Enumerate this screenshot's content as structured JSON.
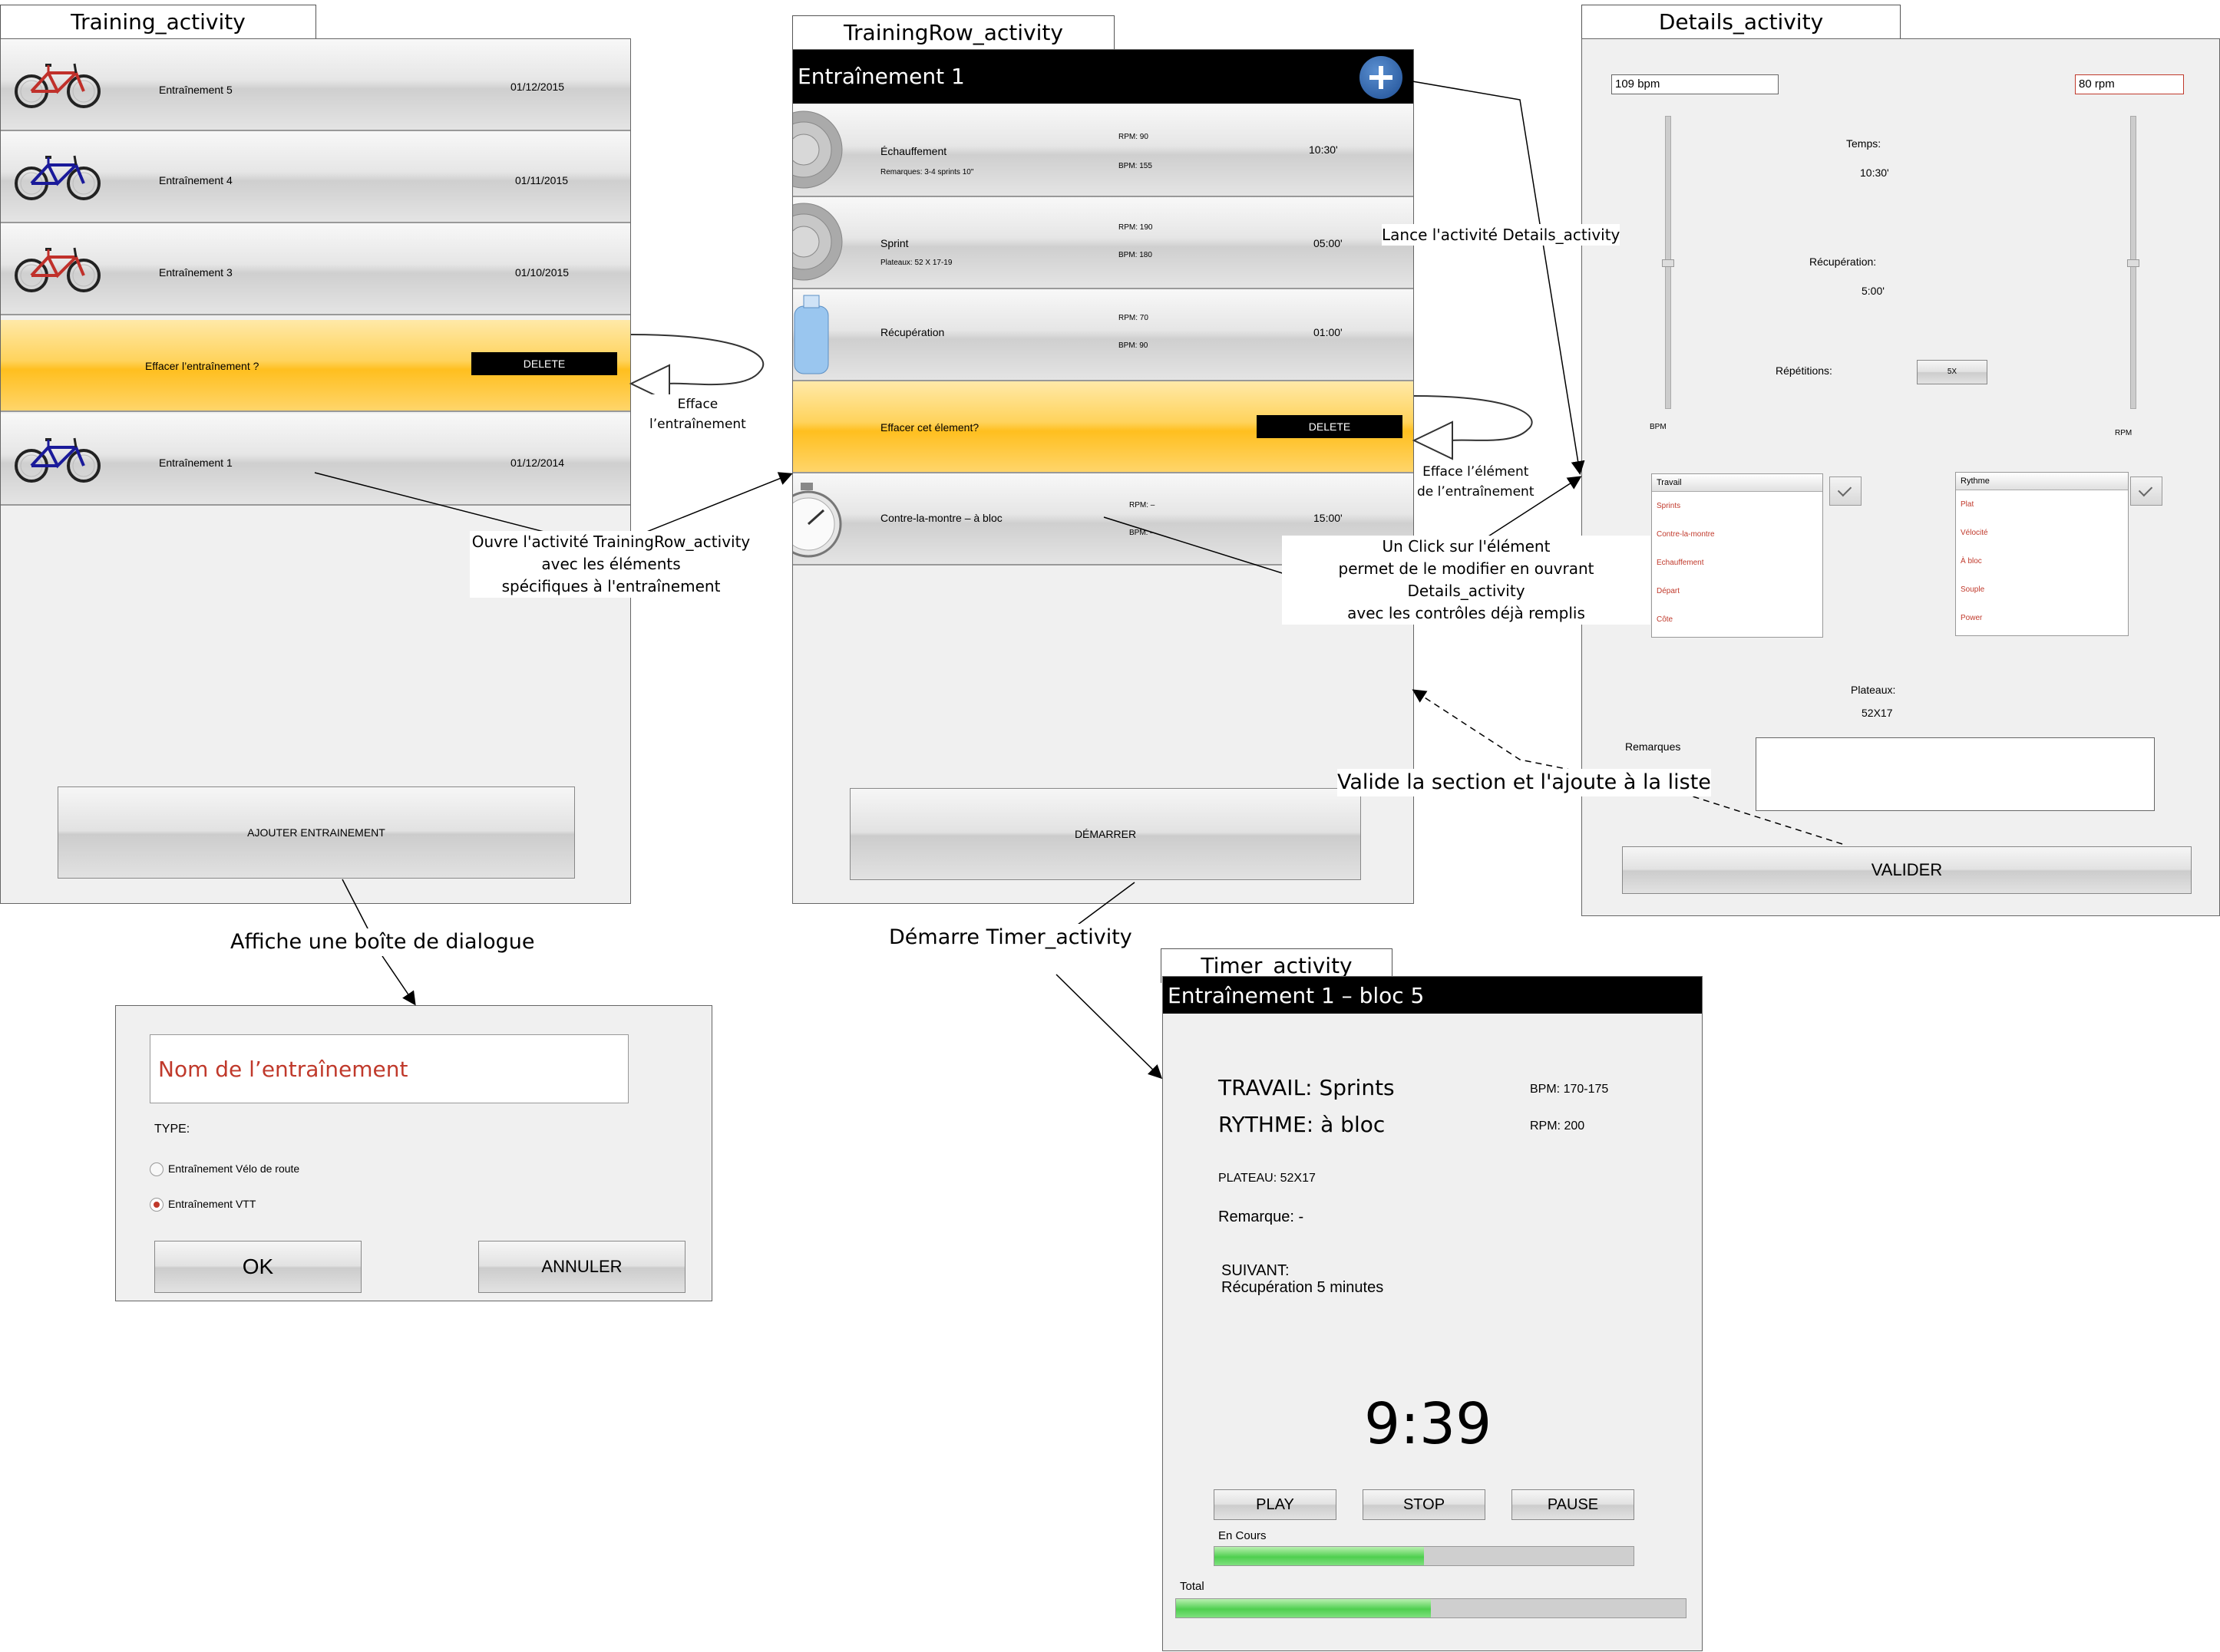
{
  "training_activity": {
    "tab": "Training_activity",
    "rows": [
      {
        "name": "Entraînement 5",
        "date": "01/12/2015",
        "bike": "red"
      },
      {
        "name": "Entraînement 4",
        "date": "01/11/2015",
        "bike": "blue"
      },
      {
        "name": "Entraînement 3",
        "date": "01/10/2015",
        "bike": "red"
      },
      {
        "name": "Entraînement 1",
        "date": "01/12/2014",
        "bike": "blue"
      }
    ],
    "delete_prompt": "Effacer l’entraînement ?",
    "delete_label": "DELETE",
    "add_button": "AJOUTER ENTRAINEMENT"
  },
  "dialog": {
    "name_placeholder": "Nom de l’entraînement",
    "type_label": "TYPE:",
    "option_road": "Entraînement Vélo de route",
    "option_vtt": "Entraînement VTT",
    "selected": "Entraînement VTT",
    "ok": "OK",
    "cancel": "ANNULER"
  },
  "trainingrow_activity": {
    "tab": "TrainingRow_activity",
    "header": "Entraînement 1",
    "rows": [
      {
        "title": "Échauffement",
        "remark": "Remarques: 3-4 sprints 10\"",
        "rpm": "RPM: 90",
        "bpm": "BPM: 155",
        "time": "10:30'",
        "icon": "cassette-icon"
      },
      {
        "title": "Sprint",
        "remark": "Plateaux: 52 X 17-19",
        "rpm": "RPM: 190",
        "bpm": "BPM: 180",
        "time": "05:00'",
        "icon": "cassette-icon"
      },
      {
        "title": "Récupération",
        "remark": "",
        "rpm": "RPM: 70",
        "bpm": "BPM: 90",
        "time": "01:00'",
        "icon": "water-bottle-icon"
      },
      {
        "title": "Contre-la-montre – à bloc",
        "remark": "",
        "rpm": "RPM: –",
        "bpm": "BPM: –",
        "time": "15:00'",
        "icon": "stopwatch-icon"
      }
    ],
    "delete_prompt": "Effacer cet élement?",
    "delete_label": "DELETE",
    "start_button": "DÉMARRER"
  },
  "details_activity": {
    "tab": "Details_activity",
    "bpm_value": "109 bpm",
    "rpm_value": "80 rpm",
    "temps_label": "Temps:",
    "temps_value": "10:30'",
    "recup_label": "Récupération:",
    "recup_value": "5:00'",
    "rep_label": "Répétitions:",
    "rep_value": "5X",
    "bpm_axis": "BPM",
    "rpm_axis": "RPM",
    "travail_head": "Travail",
    "travail_items": [
      "Sprints",
      "Contre-la-montre",
      "Echauffement",
      "Départ",
      "Côte"
    ],
    "rythme_head": "Rythme",
    "rythme_items": [
      "Plat",
      "Vélocité",
      "À bloc",
      "Souple",
      "Power"
    ],
    "plateaux_label": "Plateaux:",
    "plateaux_value": "52X17",
    "remarques_label": "Remarques",
    "valider": "VALIDER"
  },
  "timer_activity": {
    "tab": "Timer_activity",
    "header": "Entraînement 1 – bloc 5",
    "travail": "TRAVAIL: Sprints",
    "rythme": "RYTHME: à bloc",
    "bpm": "BPM: 170-175",
    "rpm": "RPM: 200",
    "plateau": "PLATEAU: 52X17",
    "remarque": "Remarque: -",
    "suivant_label": "SUIVANT:",
    "suivant_value": "Récupération 5 minutes",
    "clock": "9:39",
    "play": "PLAY",
    "stop": "STOP",
    "pause": "PAUSE",
    "en_cours_label": "En Cours",
    "en_cours_progress": 0.5,
    "total_label": "Total",
    "total_progress": 0.5
  },
  "annotations": {
    "efface_entrainement": [
      "Efface",
      "l’entraînement"
    ],
    "ouvre_trainingrow": [
      "Ouvre l'activité TrainingRow_activity",
      "avec les éléments",
      "spécifiques à l'entraînement"
    ],
    "lance_details": "Lance l'activité Details_activity",
    "efface_element": [
      "Efface l’élément",
      "de l’entraînement"
    ],
    "click_element": [
      "Un Click sur l'élément",
      "permet de le modifier en ouvrant Details_activity",
      "avec les contrôles déjà remplis"
    ],
    "valide_section": "Valide la section et l'ajoute à la liste",
    "affiche_dialogue": "Affiche une boîte de dialogue",
    "demarre_timer": "Démarre Timer_activity"
  },
  "colors": {
    "delete_row": "#ffc83a",
    "header_bg": "#000000",
    "progress_green": "#4fcf4f",
    "placeholder_red": "#c0392b",
    "add_fab": "#2a5fa0"
  }
}
